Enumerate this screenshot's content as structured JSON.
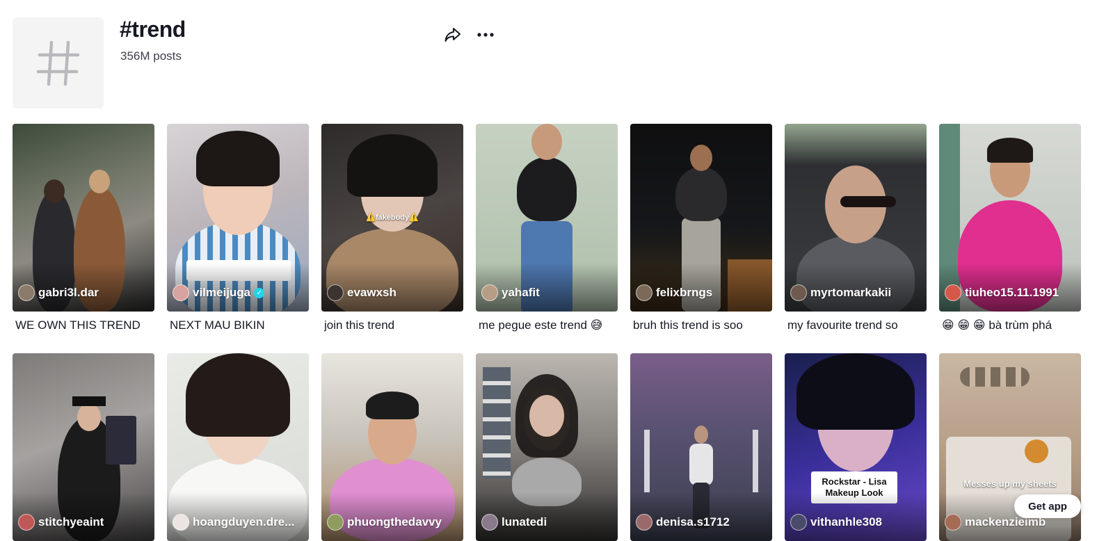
{
  "hashtag": {
    "title": "#trend",
    "post_count": "356M posts",
    "share_icon": "share-icon",
    "more_icon": "more-horizontal-icon"
  },
  "videos": [
    {
      "author": "gabri3l.dar",
      "caption": "WE OWN THIS TREND",
      "verified": false
    },
    {
      "author": "vilmeijuga",
      "caption": "NEXT MAU BIKIN",
      "verified": true
    },
    {
      "author": "evawxsh",
      "caption": "join this trend",
      "verified": false,
      "overlay": "⚠️fakebody⚠️"
    },
    {
      "author": "yahafit",
      "caption": "me pegue este trend 😅",
      "verified": false
    },
    {
      "author": "felixbrngs",
      "caption": "bruh this trend is soo",
      "verified": false
    },
    {
      "author": "myrtomarkakii",
      "caption": "my favourite trend so",
      "verified": false
    },
    {
      "author": "tiuheo15.11.1991",
      "caption": "😁 😁 😁 bà trùm phá",
      "verified": false
    },
    {
      "author": "stitchyeaint",
      "caption": "",
      "verified": false
    },
    {
      "author": "hoangduyen.dre...",
      "caption": "",
      "verified": false
    },
    {
      "author": "phuongthedavvy",
      "caption": "",
      "verified": false
    },
    {
      "author": "lunatedi",
      "caption": "",
      "verified": false
    },
    {
      "author": "denisa.s1712",
      "caption": "",
      "verified": false
    },
    {
      "author": "vithanhle308",
      "caption": "",
      "verified": false,
      "sticker": "Rockstar - Lisa Makeup Look"
    },
    {
      "author": "mackenzieimb",
      "caption": "",
      "verified": false,
      "overlay": "Messes up my sheets"
    }
  ],
  "get_app_label": "Get app",
  "colors": {
    "background": "#ffffff",
    "text": "#161823",
    "verified": "#20d5ec"
  }
}
